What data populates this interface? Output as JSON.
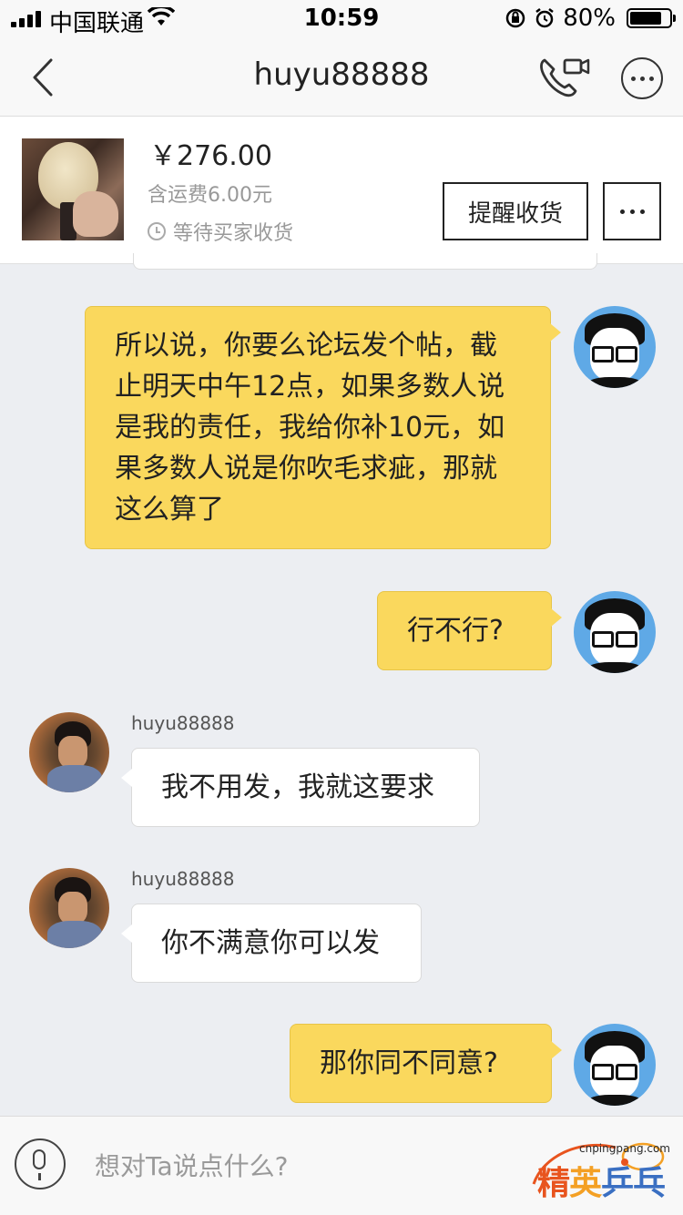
{
  "status_bar": {
    "carrier": "中国联通",
    "time": "10:59",
    "battery_percent": "80%",
    "battery_level": 0.8
  },
  "nav": {
    "title": "huyu88888"
  },
  "order": {
    "price": "￥276.00",
    "shipping": "含运费6.00元",
    "status": "等待买家收货",
    "remind_button": "提醒收货"
  },
  "messages": [
    {
      "side": "out",
      "text": "所以说，你要么论坛发个帖，截止明天中午12点，如果多数人说是我的责任，我给你补10元，如果多数人说是你吹毛求疵，那就这么算了"
    },
    {
      "side": "out",
      "text": "行不行?"
    },
    {
      "side": "in",
      "sender": "huyu88888",
      "text": "我不用发，我就这要求"
    },
    {
      "side": "in",
      "sender": "huyu88888",
      "text": "你不满意你可以发"
    },
    {
      "side": "out",
      "text": "那你同不同意?"
    }
  ],
  "input": {
    "placeholder": "想对Ta说点什么?"
  },
  "watermark": {
    "url": "cnpingpang.com",
    "part1": "精",
    "part2": "英",
    "part3": "乒乓网"
  },
  "icons": {
    "back": "chevron-left-icon",
    "video": "phone-video-icon",
    "more": "more-dots-icon",
    "clock": "clock-icon",
    "mic": "microphone-icon"
  }
}
